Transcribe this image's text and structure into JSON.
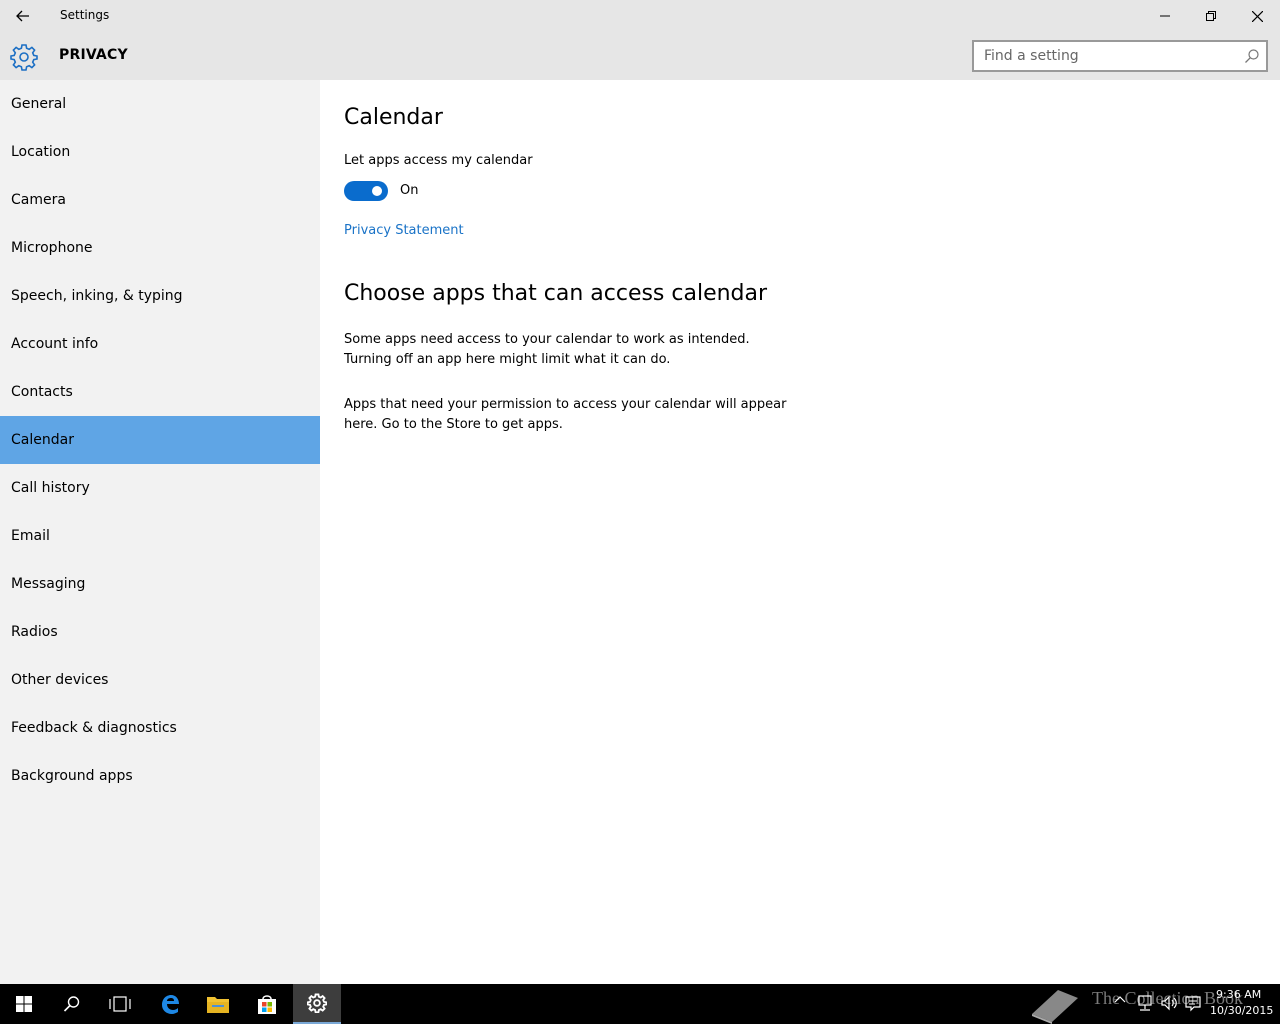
{
  "window": {
    "title": "Settings"
  },
  "header": {
    "section_title": "PRIVACY",
    "search_placeholder": "Find a setting"
  },
  "sidebar": {
    "items": [
      {
        "label": "General",
        "selected": false
      },
      {
        "label": "Location",
        "selected": false
      },
      {
        "label": "Camera",
        "selected": false
      },
      {
        "label": "Microphone",
        "selected": false
      },
      {
        "label": "Speech, inking, & typing",
        "selected": false
      },
      {
        "label": "Account info",
        "selected": false
      },
      {
        "label": "Contacts",
        "selected": false
      },
      {
        "label": "Calendar",
        "selected": true
      },
      {
        "label": "Call history",
        "selected": false
      },
      {
        "label": "Email",
        "selected": false
      },
      {
        "label": "Messaging",
        "selected": false
      },
      {
        "label": "Radios",
        "selected": false
      },
      {
        "label": "Other devices",
        "selected": false
      },
      {
        "label": "Feedback & diagnostics",
        "selected": false
      },
      {
        "label": "Background apps",
        "selected": false
      }
    ]
  },
  "content": {
    "heading": "Calendar",
    "toggle_label": "Let apps access my calendar",
    "toggle_state": "On",
    "toggle_on": true,
    "privacy_link": "Privacy Statement",
    "section_heading": "Choose apps that can access calendar",
    "paragraph1_line1": "Some apps need access to your calendar to work as intended.",
    "paragraph1_line2": "Turning off an app here might limit what it can do.",
    "paragraph2_line1": "Apps that need your permission to access your calendar will appear",
    "paragraph2_line2": "here. Go to the Store to get apps."
  },
  "taskbar": {
    "watermark": "The Collection Book",
    "time": "9:36 AM",
    "date": "10/30/2015",
    "icons": [
      "windows-start-icon",
      "search-icon",
      "task-view-icon",
      "edge-icon",
      "file-explorer-icon",
      "store-icon",
      "settings-icon"
    ]
  },
  "colors": {
    "accent": "#0a6ccd",
    "selected_nav": "#5fa5e5",
    "link": "#1a73c7",
    "titlebar": "#e6e6e6",
    "sidebar": "#f2f2f2",
    "taskbar": "#000000"
  }
}
